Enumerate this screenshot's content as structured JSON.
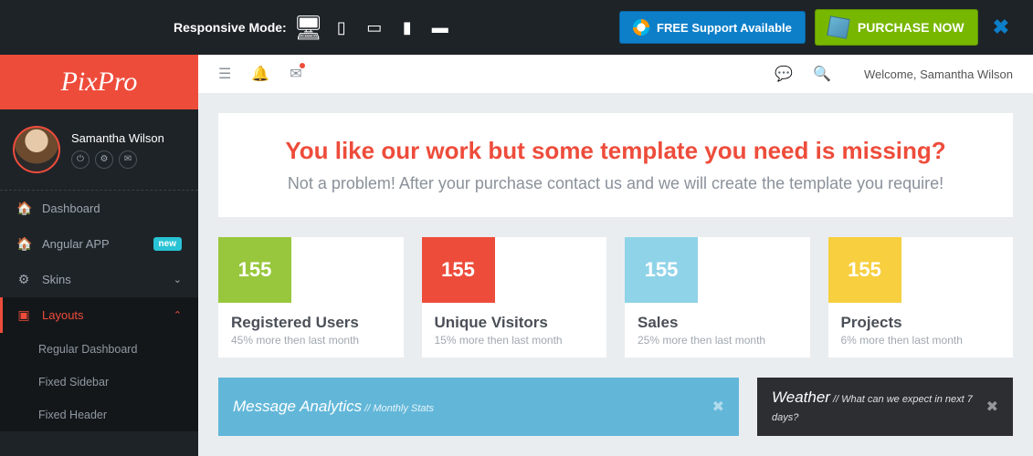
{
  "topbar": {
    "responsive_label": "Responsive Mode:",
    "support_prefix": "FREE",
    "support_label": " Support Available",
    "purchase_label": "PURCHASE NOW"
  },
  "brand": "PixPro",
  "user": {
    "name": "Samantha Wilson",
    "welcome": "Welcome, Samantha Wilson"
  },
  "menu": {
    "dashboard": "Dashboard",
    "angular": "Angular APP",
    "angular_badge": "new",
    "skins": "Skins",
    "layouts": "Layouts",
    "sub1": "Regular Dashboard",
    "sub2": "Fixed Sidebar",
    "sub3": "Fixed Header"
  },
  "banner": {
    "title": "You like our work but some template you need is missing?",
    "subtitle": "Not a problem! After your purchase contact us and we will create the template you require!"
  },
  "stats": [
    {
      "value": "155",
      "title": "Registered Users",
      "sub": "45% more then last month",
      "color": "c-green"
    },
    {
      "value": "155",
      "title": "Unique Visitors",
      "sub": "15% more then last month",
      "color": "c-red"
    },
    {
      "value": "155",
      "title": "Sales",
      "sub": "25% more then last month",
      "color": "c-blue"
    },
    {
      "value": "155",
      "title": "Projects",
      "sub": "6% more then last month",
      "color": "c-yellow"
    }
  ],
  "panels": {
    "analytics_title": "Message Analytics",
    "analytics_sub": " // Monthly Stats",
    "weather_title": "Weather",
    "weather_sub": " // What can we expect in next 7 days?"
  }
}
